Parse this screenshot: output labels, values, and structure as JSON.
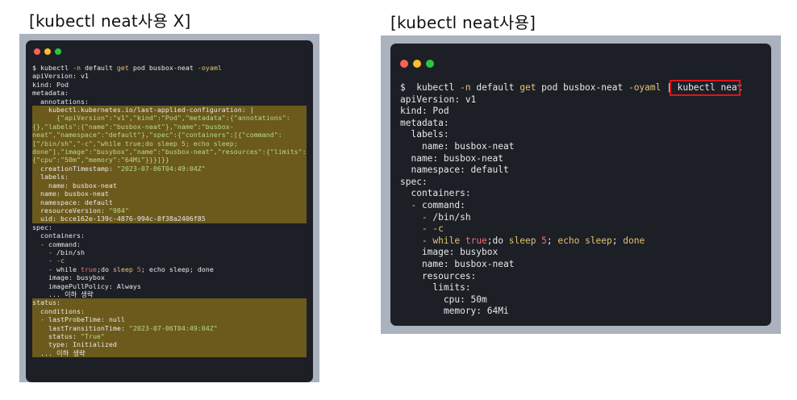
{
  "left": {
    "title": "[kubectl neat사용 X]",
    "dot_colors": [
      "#fe5f57",
      "#febc2e",
      "#28c840"
    ],
    "highlight_color": "#6b5a1c",
    "lines": [
      {
        "hl": false,
        "segs": [
          {
            "t": "$ ",
            "c": "#e8e8e8"
          },
          {
            "t": "kubectl",
            "c": "#e8e8e8"
          },
          {
            "t": " -n ",
            "c": "#e3c46e"
          },
          {
            "t": "default ",
            "c": "#e8e8e8"
          },
          {
            "t": "get",
            "c": "#e3c46e"
          },
          {
            "t": " pod busbox-neat ",
            "c": "#e8e8e8"
          },
          {
            "t": "-oyaml",
            "c": "#e3c46e"
          }
        ]
      },
      {
        "hl": false,
        "segs": [
          {
            "t": "apiVersion: v1",
            "c": "#e8e8e8"
          }
        ]
      },
      {
        "hl": false,
        "segs": [
          {
            "t": "kind: Pod",
            "c": "#e8e8e8"
          }
        ]
      },
      {
        "hl": false,
        "segs": [
          {
            "t": "metadata:",
            "c": "#e8e8e8"
          }
        ]
      },
      {
        "hl": false,
        "segs": [
          {
            "t": "  annotations:",
            "c": "#e8e8e8"
          }
        ]
      },
      {
        "hl": true,
        "segs": [
          {
            "t": "    kubectl.kubernetes.io/last-applied-configuration: |",
            "c": "#e8e8e8"
          }
        ]
      },
      {
        "hl": true,
        "segs": [
          {
            "t": "      {\"apiVersion\":\"v1\",\"kind\":\"Pod\",\"metadata\":{\"annotations\":",
            "c": "#b9d98a"
          }
        ]
      },
      {
        "hl": true,
        "segs": [
          {
            "t": "{},\"labels\":{\"name\":\"busbox-neat\"},\"name\":\"busbox-",
            "c": "#b9d98a"
          }
        ]
      },
      {
        "hl": true,
        "segs": [
          {
            "t": "neat\",\"namespace\":\"default\"},\"spec\":{\"containers\":[{\"command\":",
            "c": "#b9d98a"
          }
        ]
      },
      {
        "hl": true,
        "segs": [
          {
            "t": "[\"/bin/sh\",\"-c\",\"while true;do sleep 5; echo sleep;",
            "c": "#b9d98a"
          }
        ]
      },
      {
        "hl": true,
        "segs": [
          {
            "t": "done\"],\"image\":\"busybox\",\"name\":\"busbox-neat\",\"resources\":{\"limits\":",
            "c": "#b9d98a"
          }
        ]
      },
      {
        "hl": true,
        "segs": [
          {
            "t": "{\"cpu\":\"50m\",\"memory\":\"64Mi\"}}}]}}",
            "c": "#b9d98a"
          }
        ]
      },
      {
        "hl": true,
        "segs": [
          {
            "t": "  creationTimestamp: ",
            "c": "#e8e8e8"
          },
          {
            "t": "\"2023-07-06T04:49:04Z\"",
            "c": "#b9d98a"
          }
        ]
      },
      {
        "hl": true,
        "segs": [
          {
            "t": "  labels:",
            "c": "#e8e8e8"
          }
        ]
      },
      {
        "hl": true,
        "segs": [
          {
            "t": "    name: busbox-neat",
            "c": "#e8e8e8"
          }
        ]
      },
      {
        "hl": true,
        "segs": [
          {
            "t": "  name: busbox-neat",
            "c": "#e8e8e8"
          }
        ]
      },
      {
        "hl": true,
        "segs": [
          {
            "t": "  namespace: default",
            "c": "#e8e8e8"
          }
        ]
      },
      {
        "hl": true,
        "segs": [
          {
            "t": "  resourceVersion: ",
            "c": "#e8e8e8"
          },
          {
            "t": "\"984\"",
            "c": "#b9d98a"
          }
        ]
      },
      {
        "hl": true,
        "segs": [
          {
            "t": "  uid: bcce162e-139c-4876-994c-8f38a2406f85",
            "c": "#e8e8e8"
          }
        ]
      },
      {
        "hl": false,
        "segs": [
          {
            "t": "spec:",
            "c": "#e8e8e8"
          }
        ]
      },
      {
        "hl": false,
        "segs": [
          {
            "t": "  containers:",
            "c": "#e8e8e8"
          }
        ]
      },
      {
        "hl": false,
        "segs": [
          {
            "t": "  - ",
            "c": "#e3c46e"
          },
          {
            "t": "command:",
            "c": "#e8e8e8"
          }
        ]
      },
      {
        "hl": false,
        "segs": [
          {
            "t": "    - ",
            "c": "#e3c46e"
          },
          {
            "t": "/bin/sh",
            "c": "#e8e8e8"
          }
        ]
      },
      {
        "hl": false,
        "segs": [
          {
            "t": "    - -c",
            "c": "#e3c46e"
          }
        ]
      },
      {
        "hl": false,
        "segs": [
          {
            "t": "    - ",
            "c": "#e3c46e"
          },
          {
            "t": "while ",
            "c": "#e8e8e8"
          },
          {
            "t": "true",
            "c": "#f07178"
          },
          {
            "t": ";do ",
            "c": "#e8e8e8"
          },
          {
            "t": "sleep ",
            "c": "#e3c46e"
          },
          {
            "t": "5",
            "c": "#f07178"
          },
          {
            "t": "; echo sleep; done",
            "c": "#e8e8e8"
          }
        ]
      },
      {
        "hl": false,
        "segs": [
          {
            "t": "    image: busybox",
            "c": "#e8e8e8"
          }
        ]
      },
      {
        "hl": false,
        "segs": [
          {
            "t": "    imagePullPolicy: Always",
            "c": "#e8e8e8"
          }
        ]
      },
      {
        "hl": false,
        "segs": [
          {
            "t": "    ... 이하 생략",
            "c": "#e8e8e8"
          }
        ]
      },
      {
        "hl": true,
        "segs": [
          {
            "t": "status:",
            "c": "#e8e8e8"
          }
        ]
      },
      {
        "hl": true,
        "segs": [
          {
            "t": "  conditions:",
            "c": "#e8e8e8"
          }
        ]
      },
      {
        "hl": true,
        "segs": [
          {
            "t": "  - ",
            "c": "#e3c46e"
          },
          {
            "t": "lastProbeTime: null",
            "c": "#e8e8e8"
          }
        ]
      },
      {
        "hl": true,
        "segs": [
          {
            "t": "    lastTransitionTime: ",
            "c": "#e8e8e8"
          },
          {
            "t": "\"2023-07-06T04:49:04Z\"",
            "c": "#b9d98a"
          }
        ]
      },
      {
        "hl": true,
        "segs": [
          {
            "t": "    status: ",
            "c": "#e8e8e8"
          },
          {
            "t": "\"True\"",
            "c": "#b9d98a"
          }
        ]
      },
      {
        "hl": true,
        "segs": [
          {
            "t": "    type: Initialized",
            "c": "#e8e8e8"
          }
        ]
      },
      {
        "hl": true,
        "segs": [
          {
            "t": "  ... 이하 생략",
            "c": "#e8e8e8"
          }
        ]
      }
    ]
  },
  "right": {
    "title": "[kubectl neat사용]",
    "dot_colors": [
      "#fe5f57",
      "#febc2e",
      "#28c840"
    ],
    "box_color": "#d8171b",
    "lines": [
      {
        "hl": false,
        "segs": [
          {
            "t": "$  ",
            "c": "#e8e8e8"
          },
          {
            "t": "kubectl",
            "c": "#e8e8e8"
          },
          {
            "t": " -n ",
            "c": "#e3c46e"
          },
          {
            "t": "default ",
            "c": "#e8e8e8"
          },
          {
            "t": "get",
            "c": "#e3c46e"
          },
          {
            "t": " pod busbox-neat ",
            "c": "#e8e8e8"
          },
          {
            "t": "-oyaml",
            "c": "#e3c46e"
          },
          {
            "t": " | ",
            "c": "#e8e8e8"
          },
          {
            "t": "kubectl neat",
            "c": "#e8e8e8"
          }
        ]
      },
      {
        "hl": false,
        "segs": [
          {
            "t": "apiVersion: v1",
            "c": "#e8e8e8"
          }
        ]
      },
      {
        "hl": false,
        "segs": [
          {
            "t": "kind: Pod",
            "c": "#e8e8e8"
          }
        ]
      },
      {
        "hl": false,
        "segs": [
          {
            "t": "metadata:",
            "c": "#e8e8e8"
          }
        ]
      },
      {
        "hl": false,
        "segs": [
          {
            "t": "  labels:",
            "c": "#e8e8e8"
          }
        ]
      },
      {
        "hl": false,
        "segs": [
          {
            "t": "    name: busbox-neat",
            "c": "#e8e8e8"
          }
        ]
      },
      {
        "hl": false,
        "segs": [
          {
            "t": "  name: busbox-neat",
            "c": "#e8e8e8"
          }
        ]
      },
      {
        "hl": false,
        "segs": [
          {
            "t": "  namespace: default",
            "c": "#e8e8e8"
          }
        ]
      },
      {
        "hl": false,
        "segs": [
          {
            "t": "spec:",
            "c": "#e8e8e8"
          }
        ]
      },
      {
        "hl": false,
        "segs": [
          {
            "t": "  containers:",
            "c": "#e8e8e8"
          }
        ]
      },
      {
        "hl": false,
        "segs": [
          {
            "t": "  - ",
            "c": "#e3c46e"
          },
          {
            "t": "command:",
            "c": "#e8e8e8"
          }
        ]
      },
      {
        "hl": false,
        "segs": [
          {
            "t": "    - ",
            "c": "#e3c46e"
          },
          {
            "t": "/bin/sh",
            "c": "#e8e8e8"
          }
        ]
      },
      {
        "hl": false,
        "segs": [
          {
            "t": "    - -c",
            "c": "#e3c46e"
          }
        ]
      },
      {
        "hl": false,
        "segs": [
          {
            "t": "    - ",
            "c": "#e3c46e"
          },
          {
            "t": "while ",
            "c": "#e3c46e"
          },
          {
            "t": "true",
            "c": "#f07178"
          },
          {
            "t": ";do ",
            "c": "#e8e8e8"
          },
          {
            "t": "sleep ",
            "c": "#e3c46e"
          },
          {
            "t": "5",
            "c": "#f07178"
          },
          {
            "t": "; ",
            "c": "#e8e8e8"
          },
          {
            "t": "echo sleep",
            "c": "#e3c46e"
          },
          {
            "t": "; ",
            "c": "#e8e8e8"
          },
          {
            "t": "done",
            "c": "#e3c46e"
          }
        ]
      },
      {
        "hl": false,
        "segs": [
          {
            "t": "    image: busybox",
            "c": "#e8e8e8"
          }
        ]
      },
      {
        "hl": false,
        "segs": [
          {
            "t": "    name: busbox-neat",
            "c": "#e8e8e8"
          }
        ]
      },
      {
        "hl": false,
        "segs": [
          {
            "t": "    resources:",
            "c": "#e8e8e8"
          }
        ]
      },
      {
        "hl": false,
        "segs": [
          {
            "t": "      limits:",
            "c": "#e8e8e8"
          }
        ]
      },
      {
        "hl": false,
        "segs": [
          {
            "t": "        cpu: 50m",
            "c": "#e8e8e8"
          }
        ]
      },
      {
        "hl": false,
        "segs": [
          {
            "t": "        memory: 64Mi",
            "c": "#e8e8e8"
          }
        ]
      }
    ]
  }
}
